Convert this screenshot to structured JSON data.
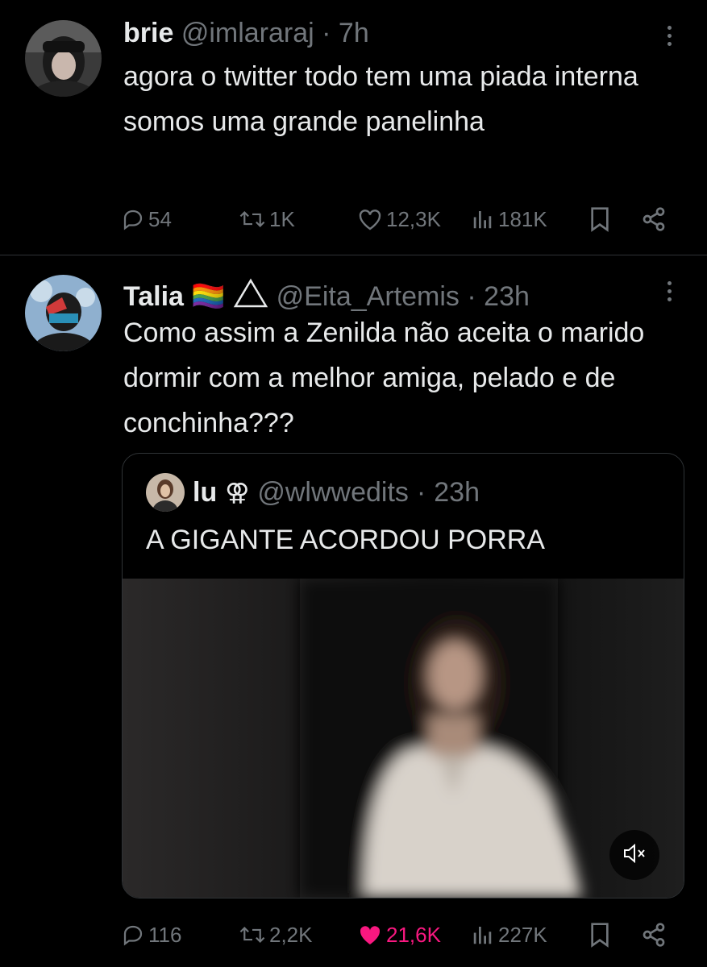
{
  "tweets": [
    {
      "name": "brie",
      "handle": "@imlararaj",
      "separator": "·",
      "time": "7h",
      "text": "agora o twitter todo tem uma piada interna somos uma grande panelinha",
      "replies": "54",
      "retweets": "1K",
      "likes": "12,3K",
      "views": "181K"
    },
    {
      "name": "Talia",
      "name_emoji": "🏳️‍🌈",
      "handle": "@Eita_Artemis",
      "separator": "·",
      "time": "23h",
      "text": "Como assim a Zenilda não aceita o marido dormir com a melhor amiga, pelado e de conchinha???",
      "replies": "116",
      "retweets": "2,2K",
      "likes": "21,6K",
      "views": "227K",
      "liked": true,
      "quote": {
        "name": "lu",
        "name_symbol": "⚢",
        "handle": "@wlwwedits",
        "separator": "·",
        "time": "23h",
        "text": "A GIGANTE ACORDOU PORRA"
      }
    }
  ],
  "colors": {
    "background": "#000000",
    "text": "#e7e9ea",
    "muted": "#71767b",
    "like_active": "#f91880",
    "divider": "#2f3336"
  },
  "icons": [
    "more-icon",
    "reply-icon",
    "retweet-icon",
    "like-icon",
    "views-icon",
    "bookmark-icon",
    "share-icon",
    "mute-icon"
  ]
}
